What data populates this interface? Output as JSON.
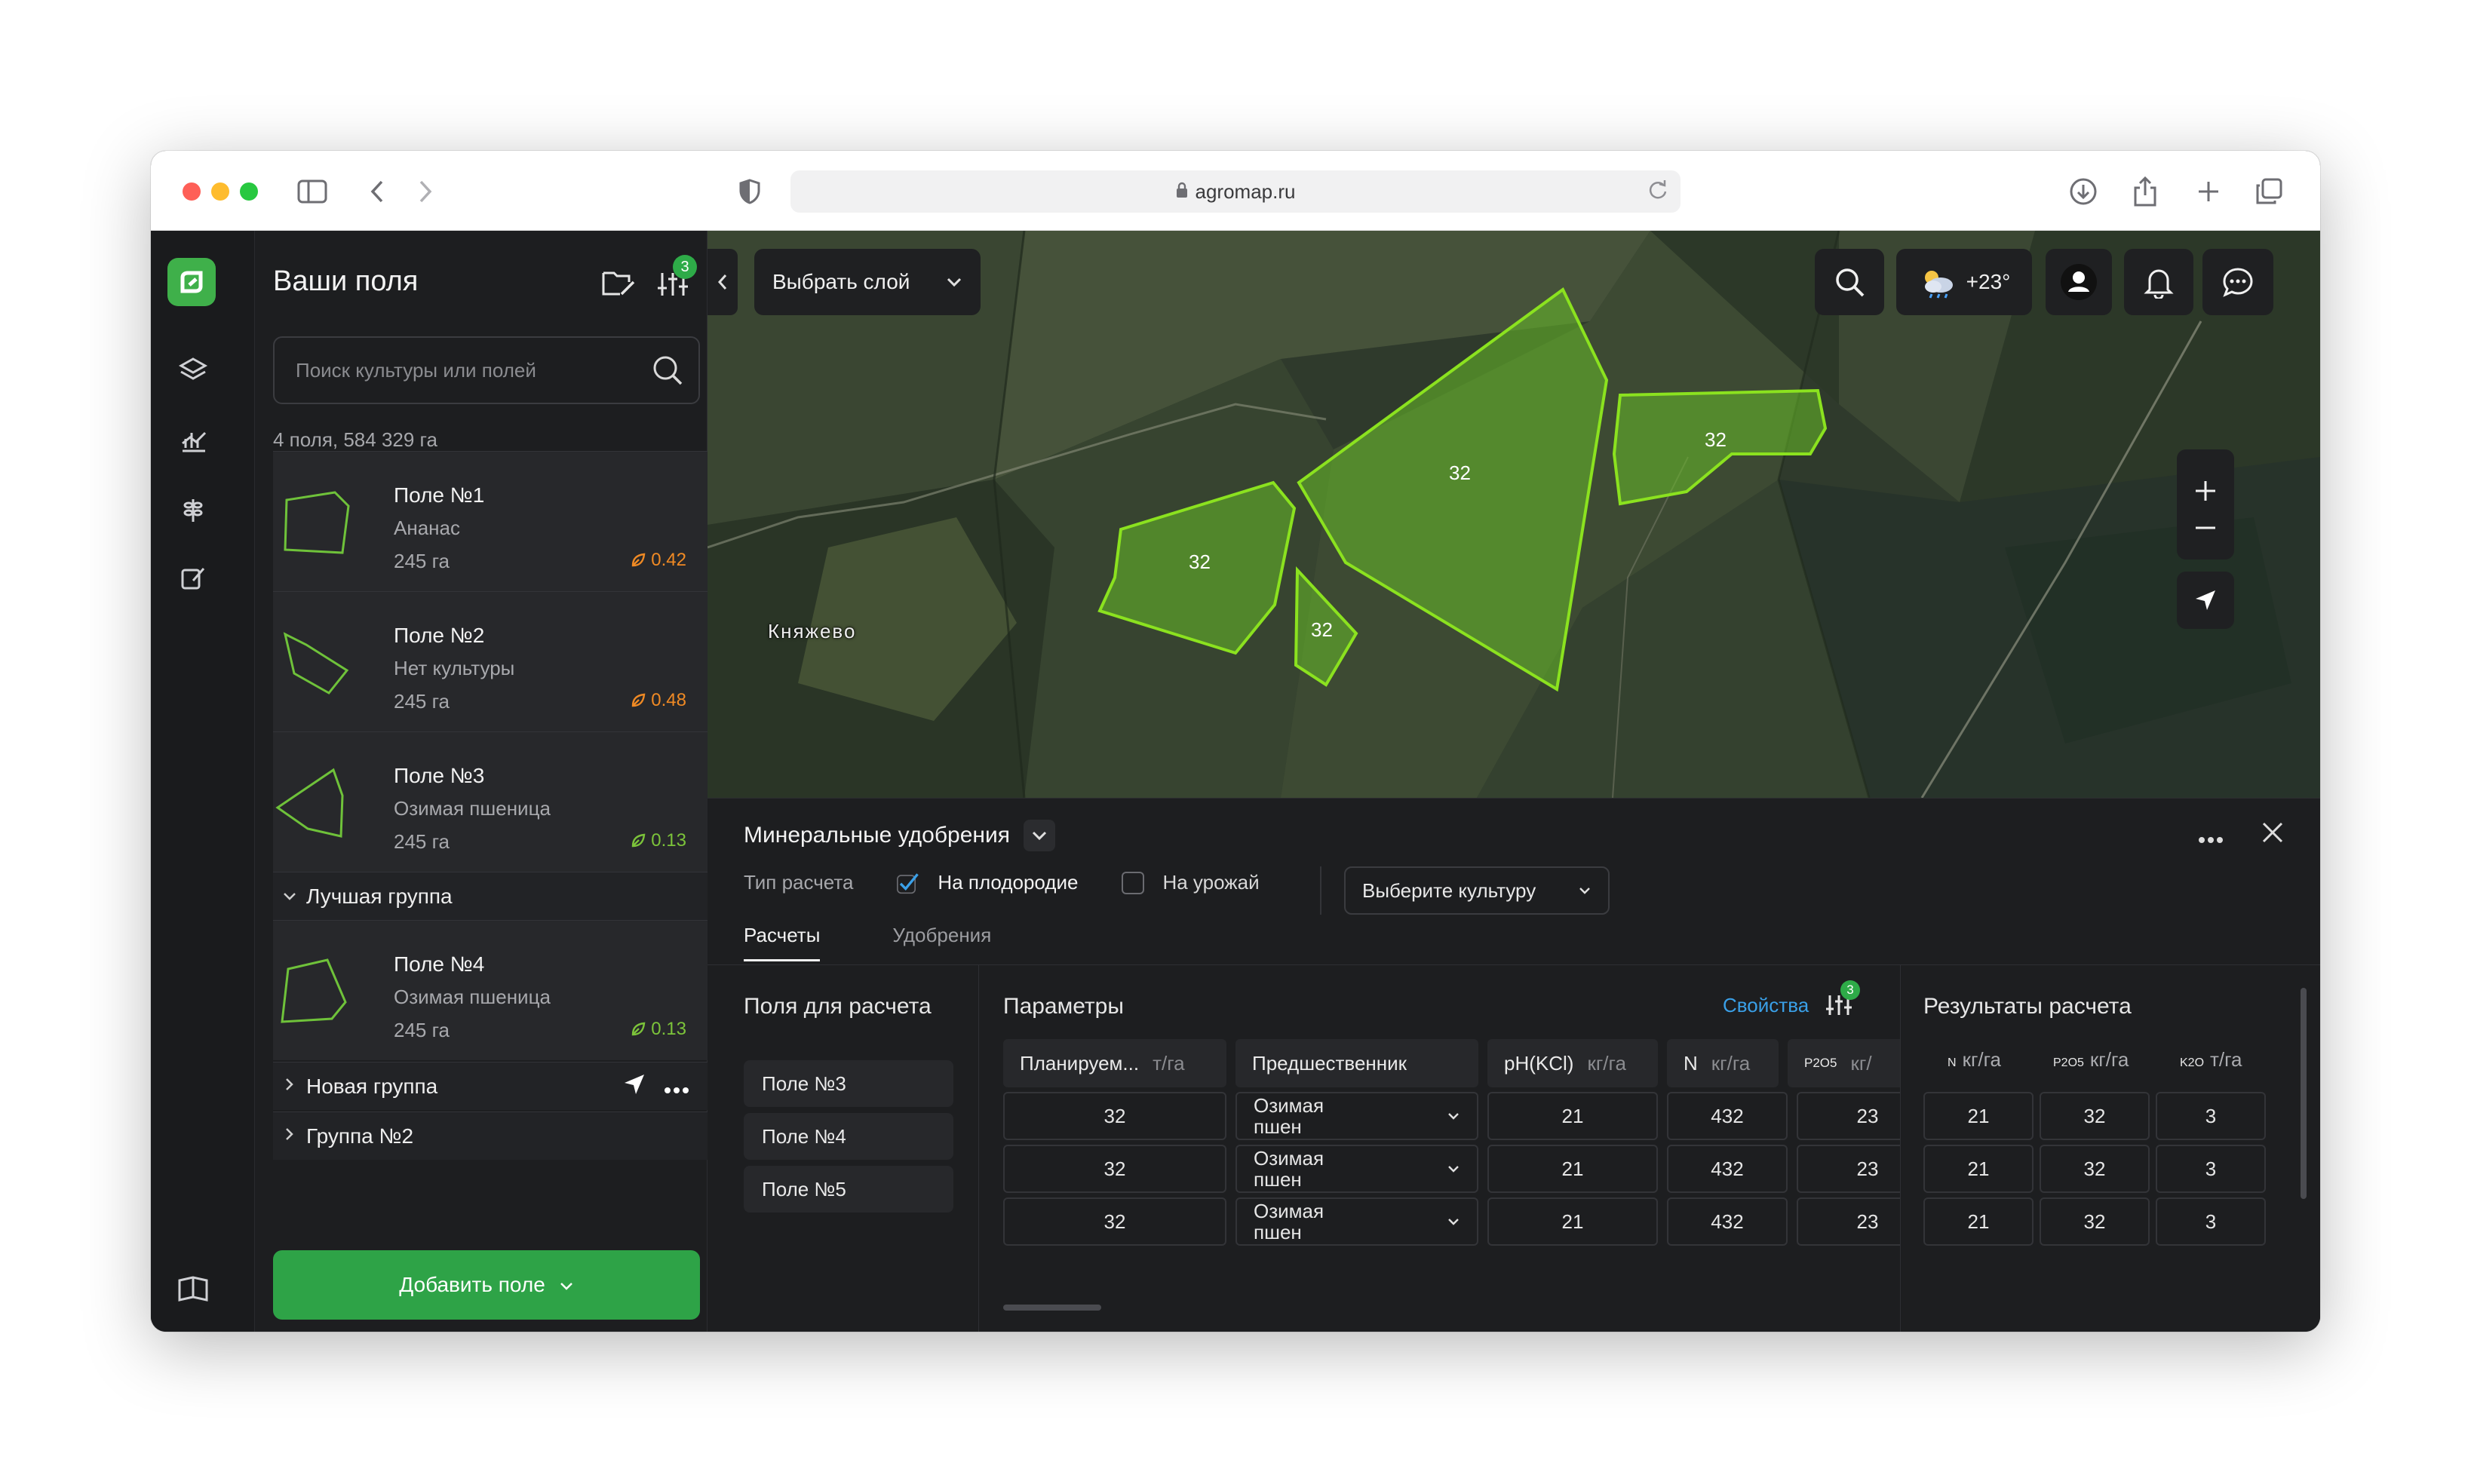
{
  "browser": {
    "url": "agromap.ru"
  },
  "sidebar": {
    "title": "Ваши поля",
    "filter_badge": "3",
    "search_placeholder": "Поиск культуры или полей",
    "summary": "4 поля, 584 329 га",
    "fields": [
      {
        "name": "Поле №1",
        "crop": "Ананас",
        "area": "245 га",
        "ndvi": "0.42",
        "ndvi_color": "#f08a24"
      },
      {
        "name": "Поле №2",
        "crop": "Нет культуры",
        "area": "245 га",
        "ndvi": "0.48",
        "ndvi_color": "#f08a24"
      },
      {
        "name": "Поле №3",
        "crop": "Озимая пшеница",
        "area": "245 га",
        "ndvi": "0.13",
        "ndvi_color": "#7cc43a"
      }
    ],
    "group_best": "Лучшая группа",
    "group_best_fields": [
      {
        "name": "Поле №4",
        "crop": "Озимая пшеница",
        "area": "245 га",
        "ndvi": "0.13",
        "ndvi_color": "#7cc43a"
      }
    ],
    "group_new": "Новая группа",
    "group_two": "Группа №2",
    "add_button": "Добавить поле"
  },
  "map": {
    "layer_select": "Выбрать слой",
    "weather": "+23°",
    "village": "Княжево",
    "polygon_labels": [
      "32",
      "32",
      "32",
      "32"
    ]
  },
  "panel": {
    "title": "Минеральные удобрения",
    "calc_type_label": "Тип расчета",
    "option_fertility": "На плодородие",
    "option_yield": "На урожай",
    "crop_select": "Выберите культуру",
    "tabs": [
      "Расчеты",
      "Удобрения"
    ],
    "fields_header": "Поля для расчета",
    "fields_list": [
      "Поле №3",
      "Поле №4",
      "Поле №5"
    ],
    "params_header": "Параметры",
    "props_link": "Свойства",
    "props_badge": "3",
    "columns": [
      {
        "label": "Планируем...",
        "unit": "т/га"
      },
      {
        "label": "Предшественник",
        "unit": ""
      },
      {
        "label": "pH(KCl)",
        "unit": "кг/га"
      },
      {
        "label": "N",
        "unit": "кг/га"
      },
      {
        "label": "P2O5",
        "unit": "кг/"
      }
    ],
    "rows": [
      {
        "plan": "32",
        "pred_line1": "Озимая",
        "pred_line2": "пшен",
        "ph": "21",
        "n": "432",
        "p": "23"
      },
      {
        "plan": "32",
        "pred_line1": "Озимая",
        "pred_line2": "пшен",
        "ph": "21",
        "n": "432",
        "p": "23"
      },
      {
        "plan": "32",
        "pred_line1": "Озимая",
        "pred_line2": "пшен",
        "ph": "21",
        "n": "432",
        "p": "23"
      }
    ],
    "results_header": "Результаты расчета",
    "result_columns": [
      {
        "sub": "N",
        "unit": "кг/га"
      },
      {
        "sub": "P2O5",
        "unit": "кг/га"
      },
      {
        "sub": "K2O",
        "unit": "т/га"
      }
    ],
    "results": [
      {
        "n": "21",
        "p": "32",
        "k": "3"
      },
      {
        "n": "21",
        "p": "32",
        "k": "3"
      },
      {
        "n": "21",
        "p": "32",
        "k": "3"
      }
    ]
  }
}
